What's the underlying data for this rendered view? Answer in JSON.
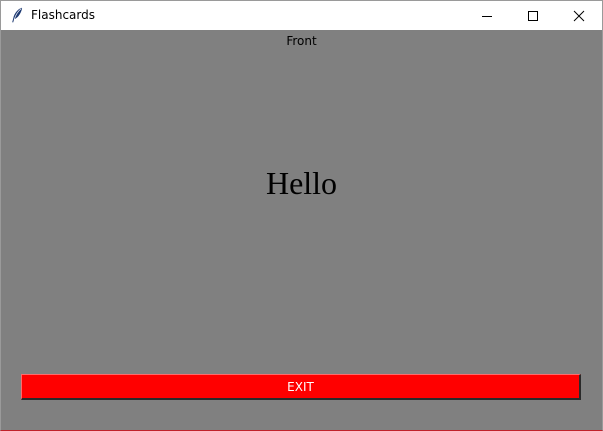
{
  "window": {
    "title": "Flashcards",
    "icon": "feather-icon",
    "controls": {
      "minimize": "minimize-icon",
      "maximize": "maximize-icon",
      "close": "close-icon"
    }
  },
  "card": {
    "side_label": "Front",
    "word": "Hello"
  },
  "actions": {
    "exit_label": "EXIT"
  },
  "colors": {
    "background": "#808080",
    "exit_button": "#ff0000",
    "exit_text": "#ffffff"
  }
}
